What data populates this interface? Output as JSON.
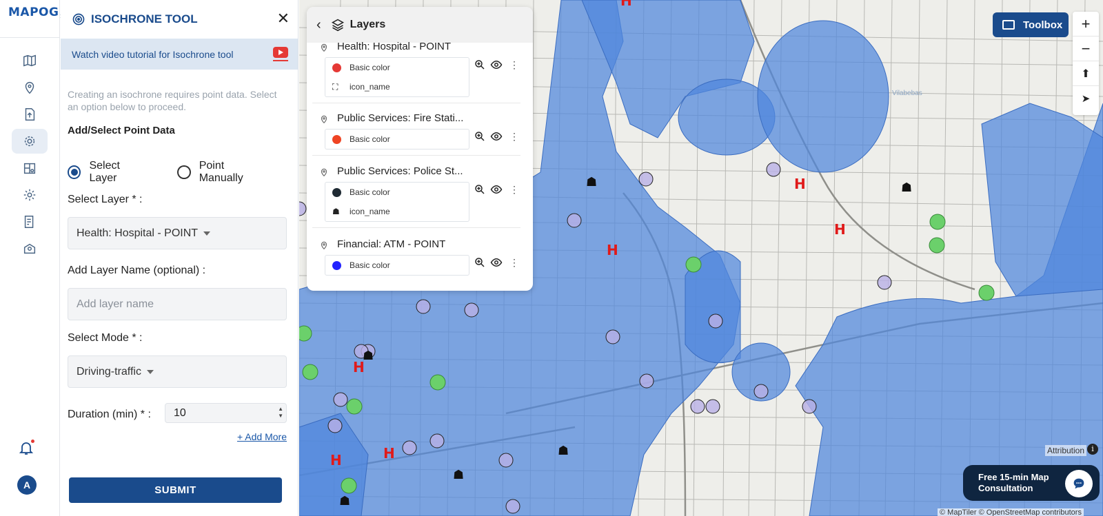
{
  "app": {
    "logo_text": "MAPOG"
  },
  "isochrone": {
    "title": "ISOCHRONE TOOL",
    "tutorial_text": "Watch video tutorial for Isochrone tool",
    "hint": "Creating an isochrone requires point data. Select an option below to proceed.",
    "section_title": "Add/Select Point Data",
    "radio_select_layer": "Select Layer",
    "radio_point_manually": "Point Manually",
    "select_layer_label": "Select Layer * :",
    "select_layer_value": "Health: Hospital - POINT",
    "layer_name_label": "Add Layer Name (optional) :",
    "layer_name_placeholder": "Add layer name",
    "mode_label": "Select Mode * :",
    "mode_value": "Driving-traffic",
    "duration_label": "Duration (min) * :",
    "duration_value": "10",
    "add_more": "+ Add More",
    "submit": "SUBMIT"
  },
  "user": {
    "avatar_initial": "A"
  },
  "layers_panel": {
    "title": "Layers",
    "layers": [
      {
        "name": "Health: Hospital - POINT",
        "rows": [
          {
            "label": "Basic color",
            "color": "#e53935"
          },
          {
            "label": "icon_name",
            "icon": "hospital"
          }
        ]
      },
      {
        "name": "Public Services: Fire Stati...",
        "rows": [
          {
            "label": "Basic color",
            "color": "#ef4423"
          }
        ]
      },
      {
        "name": "Public Services: Police St...",
        "rows": [
          {
            "label": "Basic color",
            "color": "#1f2a33"
          },
          {
            "label": "icon_name",
            "icon": "police"
          }
        ]
      },
      {
        "name": "Financial: ATM - POINT",
        "rows": [
          {
            "label": "Basic color",
            "color": "#2323ff"
          }
        ]
      }
    ]
  },
  "map": {
    "toolbox_label": "Toolbox",
    "zoom_in": "+",
    "zoom_out": "−",
    "attribution": "Attribution",
    "chat_line1": "Free 15-min Map",
    "chat_line2": "Consultation",
    "copyright": "© MapTiler © OpenStreetMap contributors",
    "label_vilabebas": "Vilabebas"
  },
  "colors": {
    "brand": "#1a4b8c",
    "isochrone_fill": "#4f86dd",
    "atm": "#b9b0e6",
    "green": "#6bd06b"
  }
}
